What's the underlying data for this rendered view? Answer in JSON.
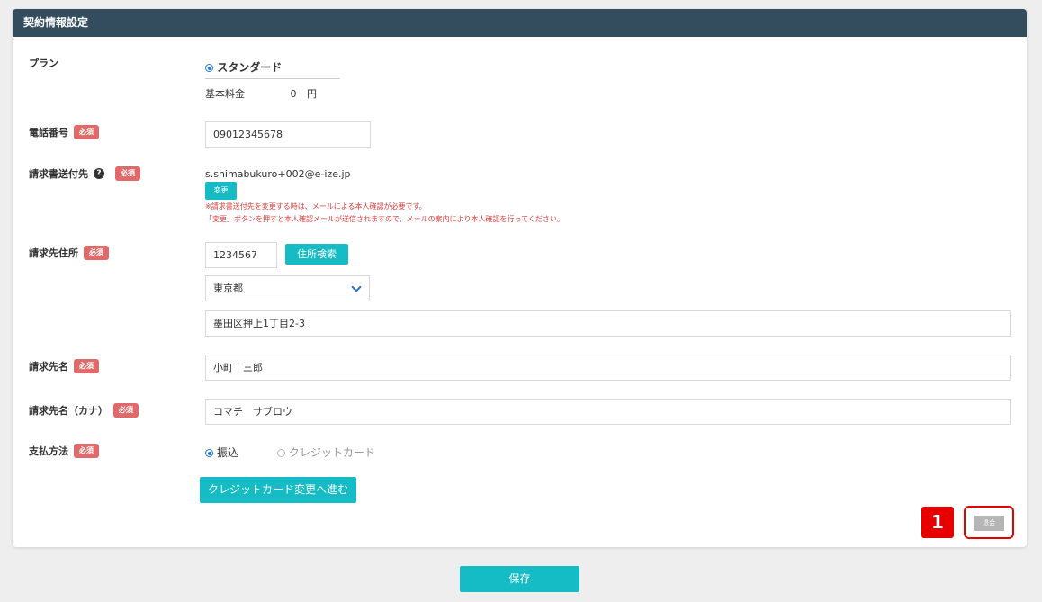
{
  "header": {
    "title": "契約情報設定"
  },
  "required_badge": "必須",
  "plan": {
    "label": "プラン",
    "selected": "スタンダード",
    "fee_label": "基本料金",
    "fee_value": "0",
    "fee_unit": "円"
  },
  "phone": {
    "label": "電話番号",
    "value": "09012345678"
  },
  "invoice_dest": {
    "label": "請求書送付先",
    "help_icon": "question-circle-icon",
    "email": "s.shimabukuro+002@e-ize.jp",
    "change_label": "変更",
    "note1": "※請求書送付先を変更する時は、メールによる本人確認が必要です。",
    "note2": "「変更」ボタンを押すと本人確認メールが送信されますので、メールの案内により本人確認を行ってください。"
  },
  "address": {
    "label": "請求先住所",
    "postal": "1234567",
    "search_label": "住所検索",
    "prefecture": "東京都",
    "street": "墨田区押上1丁目2-3"
  },
  "billing_name": {
    "label": "請求先名",
    "value": "小町　三郎"
  },
  "billing_kana": {
    "label": "請求先名（カナ）",
    "value": "コマチ　サブロウ"
  },
  "payment": {
    "label": "支払方法",
    "options": [
      "振込",
      "クレジットカード"
    ],
    "selected": "振込",
    "credit_change_label": "クレジットカード変更へ進む"
  },
  "annotation": {
    "number": "1"
  },
  "withdraw_label": "退会",
  "save_label": "保存",
  "colors": {
    "header": "#334d5e",
    "accent": "#15bcc6",
    "required": "#e06a6a",
    "annotation": "#e60000"
  }
}
